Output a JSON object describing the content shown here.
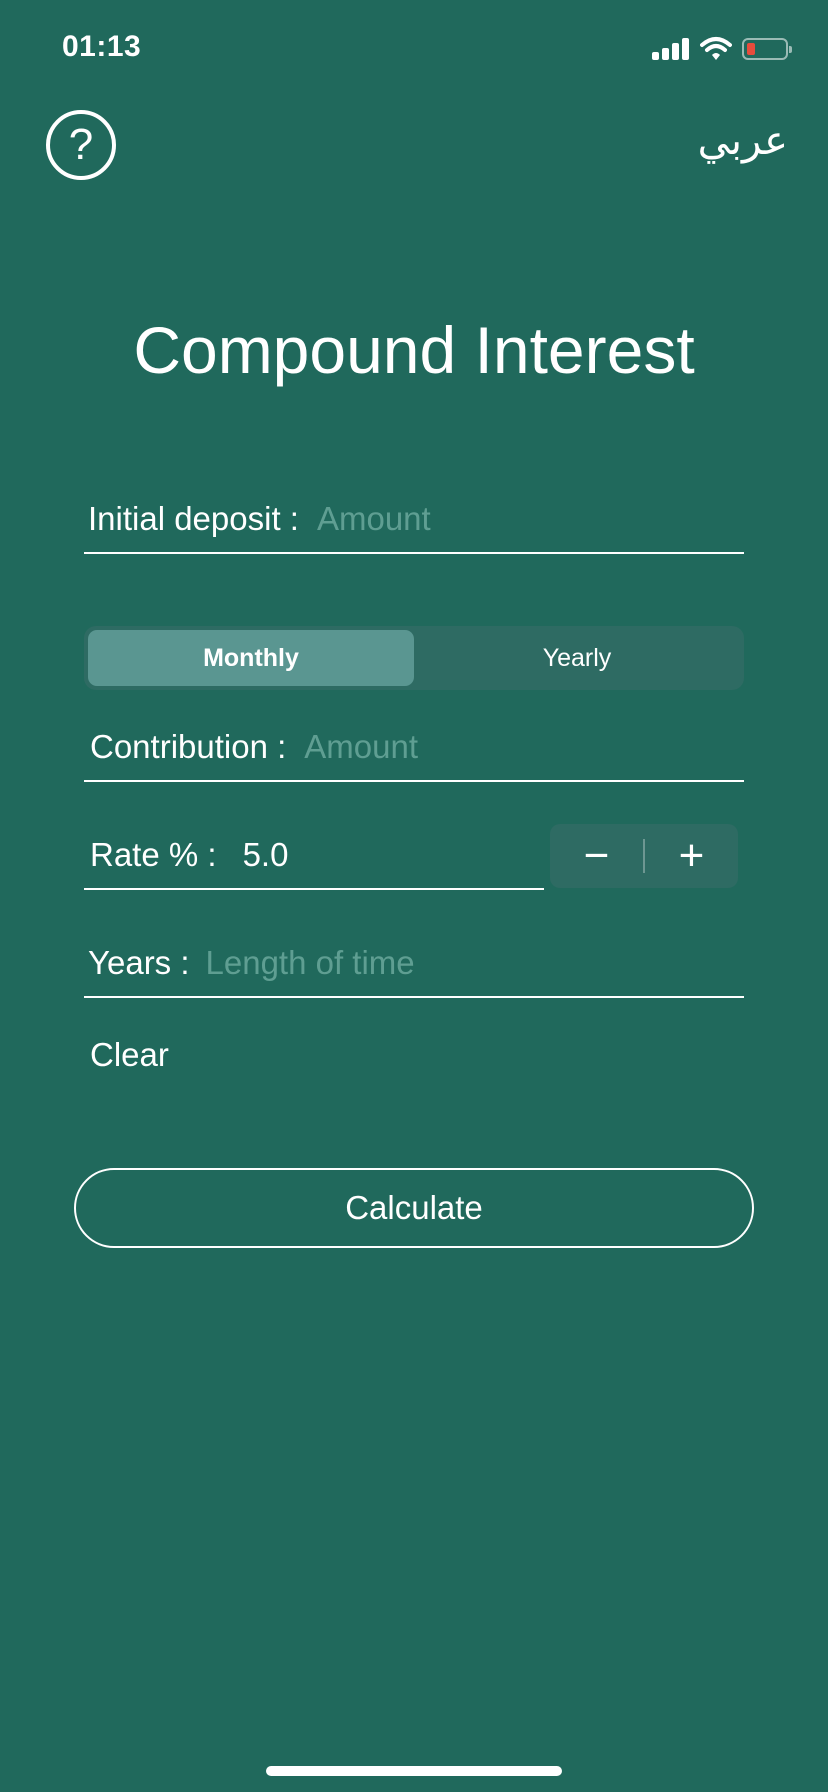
{
  "status_bar": {
    "time": "01:13",
    "signal_icon": "cellular-signal-icon",
    "wifi_icon": "wifi-icon",
    "battery_icon": "battery-low-icon",
    "battery_color": "#e74c3c"
  },
  "nav": {
    "help_icon": "question-mark-circle-icon",
    "help_glyph": "?",
    "language_label": "عربي"
  },
  "title": "Compound Interest",
  "fields": {
    "initial_deposit": {
      "label": "Initial deposit :",
      "placeholder": "Amount"
    },
    "contribution": {
      "label": "Contribution :",
      "placeholder": "Amount"
    },
    "rate": {
      "label": "Rate % :",
      "value": "5.0"
    },
    "years": {
      "label": "Years :",
      "placeholder": "Length of time"
    }
  },
  "frequency": {
    "options": [
      "Monthly",
      "Yearly"
    ],
    "selected": "Monthly"
  },
  "stepper": {
    "minus": "−",
    "plus": "+"
  },
  "clear_label": "Clear",
  "calculate_label": "Calculate",
  "colors": {
    "background": "#20695c",
    "placeholder": "#5f9e92",
    "segment_active": "#5a9691",
    "control_bg": "#2e6b63"
  }
}
